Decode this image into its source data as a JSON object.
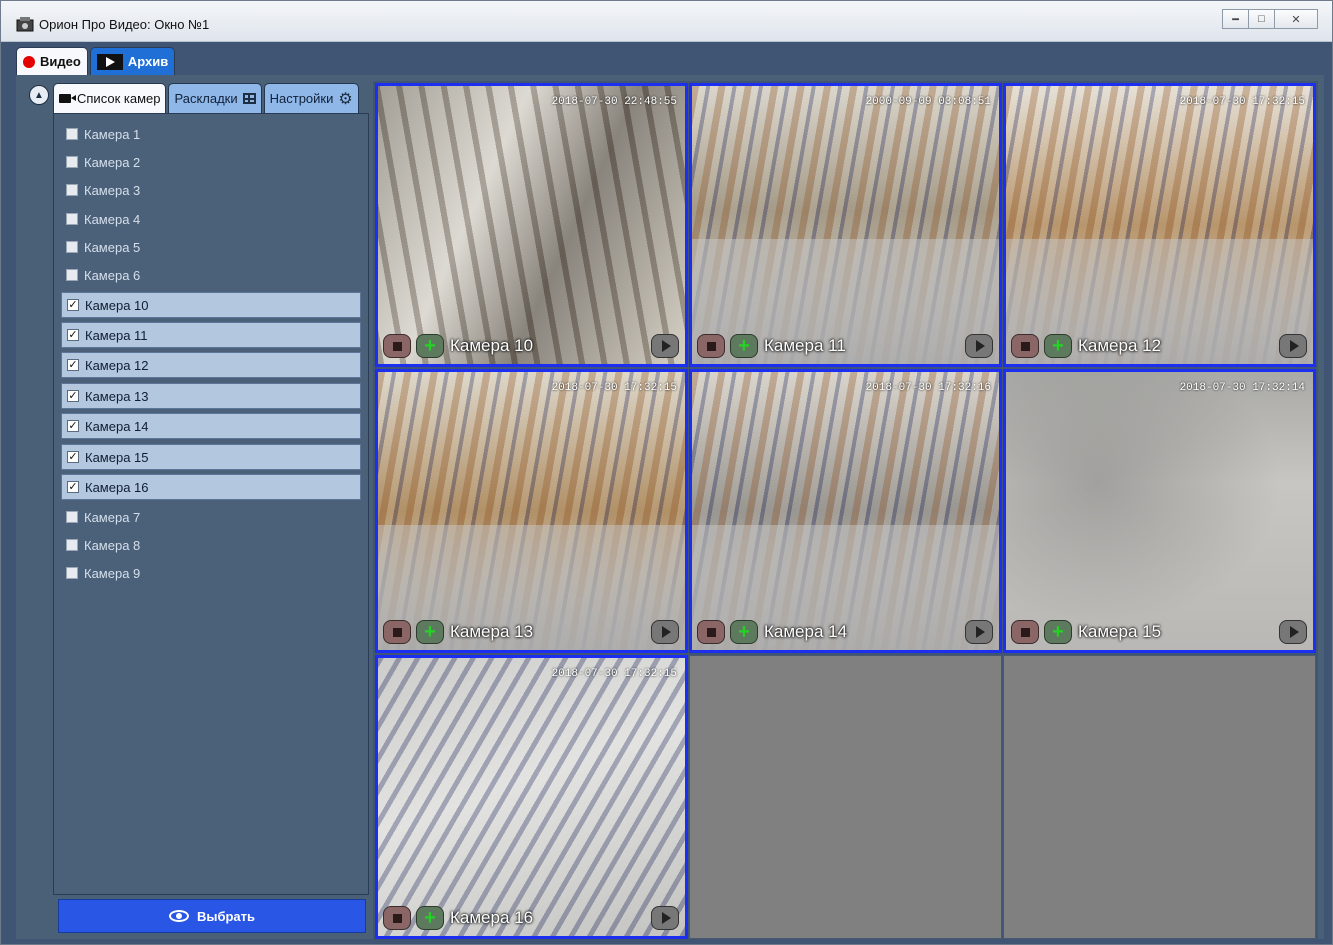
{
  "window": {
    "title": "Орион Про Видео: Окно №1",
    "controls": [
      "minimize",
      "maximize",
      "close"
    ]
  },
  "top_tabs": [
    {
      "label": "Видео",
      "active": true,
      "icon": "record-dot-icon"
    },
    {
      "label": "Архив",
      "active": false,
      "icon": "film-icon"
    }
  ],
  "sub_tabs": [
    {
      "label": "Список камер",
      "active": true,
      "icon": "camera-icon"
    },
    {
      "label": "Раскладки",
      "active": false,
      "icon": "grid-icon"
    },
    {
      "label": "Настройки",
      "active": false,
      "icon": "gear-icon"
    }
  ],
  "camera_list": [
    {
      "label": "Камера 1",
      "checked": false
    },
    {
      "label": "Камера 2",
      "checked": false
    },
    {
      "label": "Камера 3",
      "checked": false
    },
    {
      "label": "Камера 4",
      "checked": false
    },
    {
      "label": "Камера 5",
      "checked": false
    },
    {
      "label": "Камера 6",
      "checked": false
    },
    {
      "label": "Камера 10",
      "checked": true
    },
    {
      "label": "Камера 11",
      "checked": true
    },
    {
      "label": "Камера 12",
      "checked": true
    },
    {
      "label": "Камера 13",
      "checked": true
    },
    {
      "label": "Камера 14",
      "checked": true
    },
    {
      "label": "Камера 15",
      "checked": true
    },
    {
      "label": "Камера 16",
      "checked": true
    },
    {
      "label": "Камера 7",
      "checked": false
    },
    {
      "label": "Камера 8",
      "checked": false
    },
    {
      "label": "Камера 9",
      "checked": false
    }
  ],
  "select_button": {
    "label": "Выбрать",
    "icon": "eye-icon"
  },
  "video_tiles": [
    {
      "name": "Камера 10",
      "timestamp": "2018-07-30 22:48:55",
      "status": "recording"
    },
    {
      "name": "Камера 11",
      "timestamp": "2000-09-09 03:08:51",
      "status": "stopped"
    },
    {
      "name": "Камера 12",
      "timestamp": "2018-07-30 17:32:15",
      "status": "recording"
    },
    {
      "name": "Камера 13",
      "timestamp": "2018-07-30 17:32:15",
      "status": "stopped"
    },
    {
      "name": "Камера 14",
      "timestamp": "2018-07-30 17:32:16",
      "status": "stopped"
    },
    {
      "name": "Камера 15",
      "timestamp": "2018-07-30 17:32:14",
      "status": "stopped"
    },
    {
      "name": "Камера 16",
      "timestamp": "2018-07-30 17:32:15",
      "status": "stopped"
    },
    {
      "name": "",
      "timestamp": "",
      "status": "empty"
    },
    {
      "name": "",
      "timestamp": "",
      "status": "empty"
    }
  ],
  "colors": {
    "window_bg": "#3f5573",
    "panel_bg": "#4b6179",
    "tile_border": "#1c2ff0",
    "select_button": "#2a56e6",
    "record_dot": "#e40000",
    "add_cross": "#26d126",
    "empty_tile": "#808080"
  }
}
